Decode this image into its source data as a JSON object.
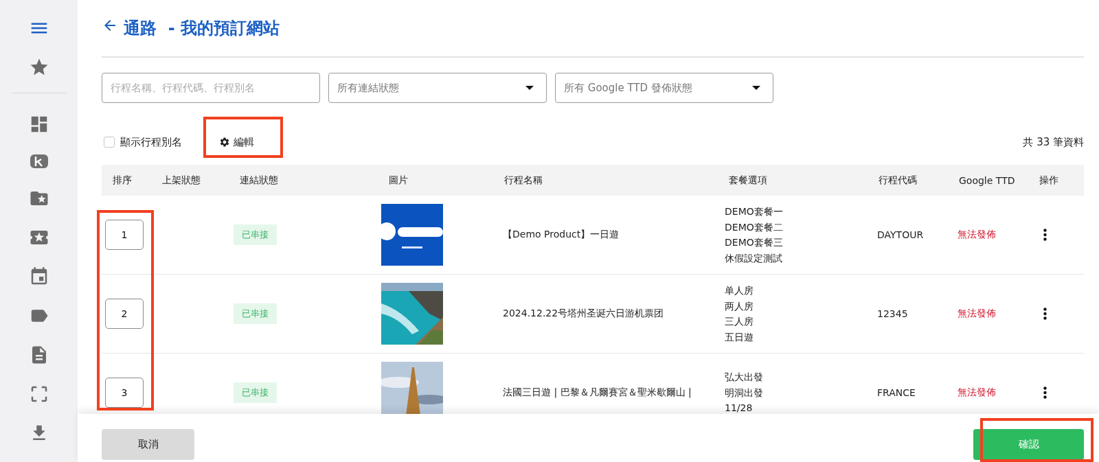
{
  "page": {
    "title": "通路  - 我的預訂網站"
  },
  "filters": {
    "search": {
      "placeholder": "行程名稱、行程代碼、行程別名"
    },
    "dropdowns": [
      {
        "placeholder": "所有連結狀態"
      },
      {
        "placeholder": "所有 Google TTD 發佈狀態"
      }
    ]
  },
  "options": {
    "show_alias": {
      "label": "顯示行程別名",
      "checked": false
    },
    "edit_button": "編輯",
    "total": "共 33 筆資料"
  },
  "table": {
    "columns": [
      "排序",
      "上架狀態",
      "連結狀態",
      "圖片",
      "行程名稱",
      "套餐選項",
      "行程代碼",
      "Google TTD",
      "操作"
    ],
    "rows": [
      {
        "order": "1",
        "link_status": "已串接",
        "image": {
          "kind": "picture"
        },
        "name": "【Demo Product】一日遊",
        "packages": [
          "DEMO套餐一",
          "DEMO套餐二",
          "DEMO套餐三",
          "休假設定測試"
        ],
        "code": "DAYTOUR",
        "google_ttd": "無法發佈"
      },
      {
        "order": "2",
        "link_status": "已串接",
        "image": {
          "kind": "picture"
        },
        "name": "2024.12.22号塔州圣诞六日游机票团",
        "packages": [
          "单人房",
          "两人房",
          "三人房",
          "五日遊"
        ],
        "code": "12345",
        "google_ttd": "無法發佈"
      },
      {
        "order": "3",
        "link_status": "已串接",
        "image": {
          "kind": "picture"
        },
        "name": "法國三日遊 | 巴黎＆凡爾賽宮＆聖米歇爾山 |",
        "packages": [
          "弘大出發",
          "明洞出發",
          "11/28"
        ],
        "code": "FRANCE",
        "google_ttd": "無法發佈"
      }
    ]
  },
  "footer": {
    "cancel": "取消",
    "confirm": "確認"
  }
}
